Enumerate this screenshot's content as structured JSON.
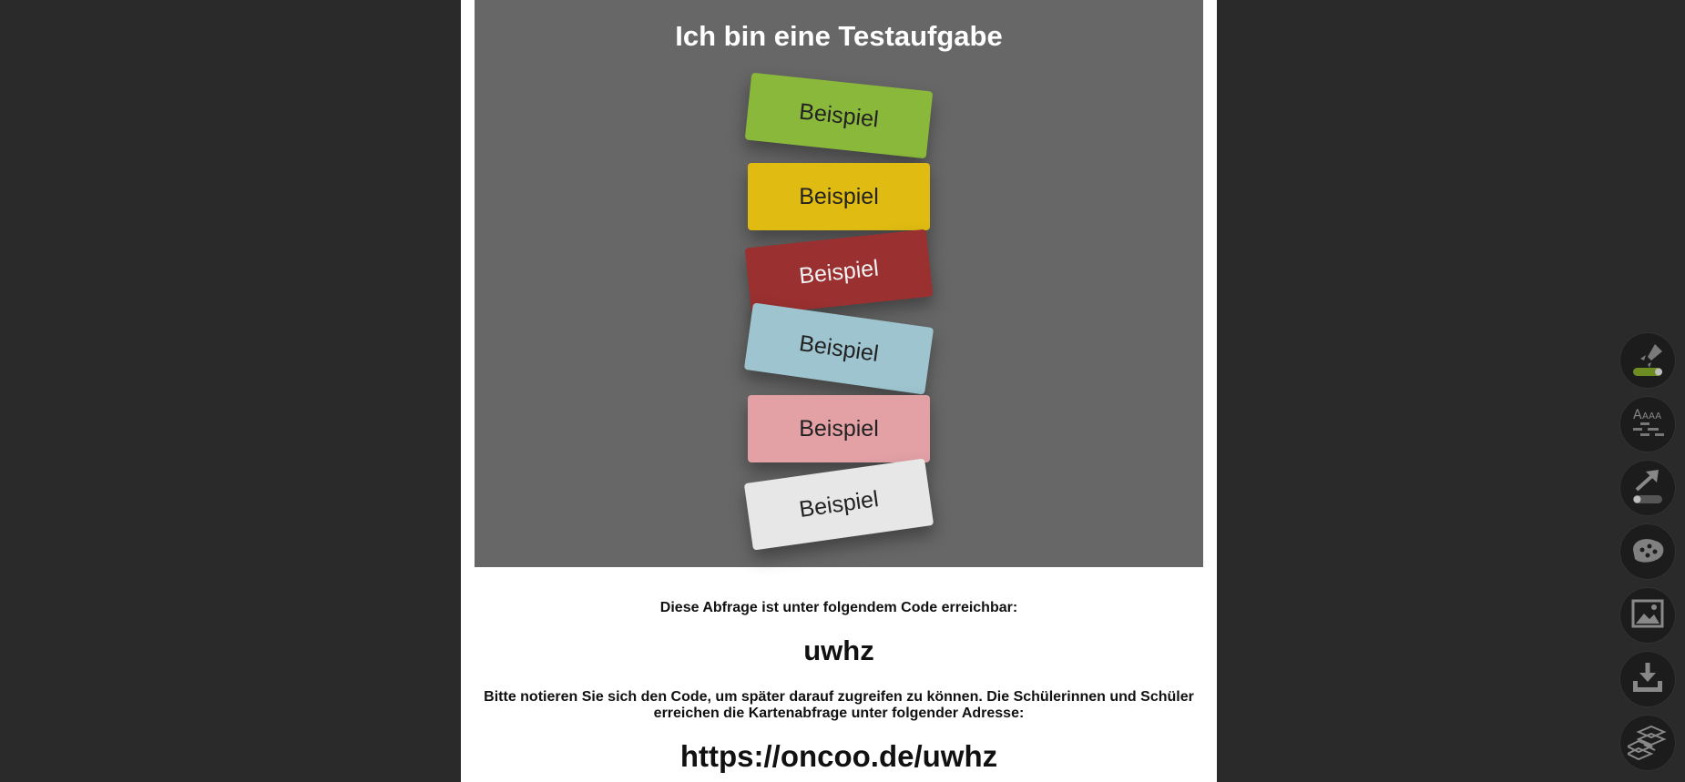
{
  "board": {
    "title": "Ich bin eine Testaufgabe",
    "cards": [
      {
        "label": "Beispiel",
        "color": "#8ab83b",
        "text_color": "#222222"
      },
      {
        "label": "Beispiel",
        "color": "#e0bc12",
        "text_color": "#222222"
      },
      {
        "label": "Beispiel",
        "color": "#9a3030",
        "text_color": "#f2f2f2"
      },
      {
        "label": "Beispiel",
        "color": "#9dc4cf",
        "text_color": "#222222"
      },
      {
        "label": "Beispiel",
        "color": "#e3a1a6",
        "text_color": "#222222"
      },
      {
        "label": "Beispiel",
        "color": "#e7e7e7",
        "text_color": "#222222"
      }
    ]
  },
  "info": {
    "label": "Diese Abfrage ist unter folgendem Code erreichbar:",
    "code": "uwhz",
    "note": "Bitte notieren Sie sich den Code, um später darauf zugreifen zu können. Die Schülerinnen und Schüler erreichen die Kartenabfrage unter folgender Adresse:",
    "url": "https://oncoo.de/uwhz"
  },
  "tools": [
    {
      "icon": "rocket-toggle-icon"
    },
    {
      "icon": "font-size-layout-icon"
    },
    {
      "icon": "export-arrow-toggle-icon"
    },
    {
      "icon": "pinboard-blob-icon"
    },
    {
      "icon": "image-icon"
    },
    {
      "icon": "download-tray-icon"
    },
    {
      "icon": "layers-stack-icon"
    }
  ],
  "colors": {
    "page_background": "#2a2a2a",
    "board_background": "#676767",
    "toggle_active": "#7a9a2a"
  }
}
